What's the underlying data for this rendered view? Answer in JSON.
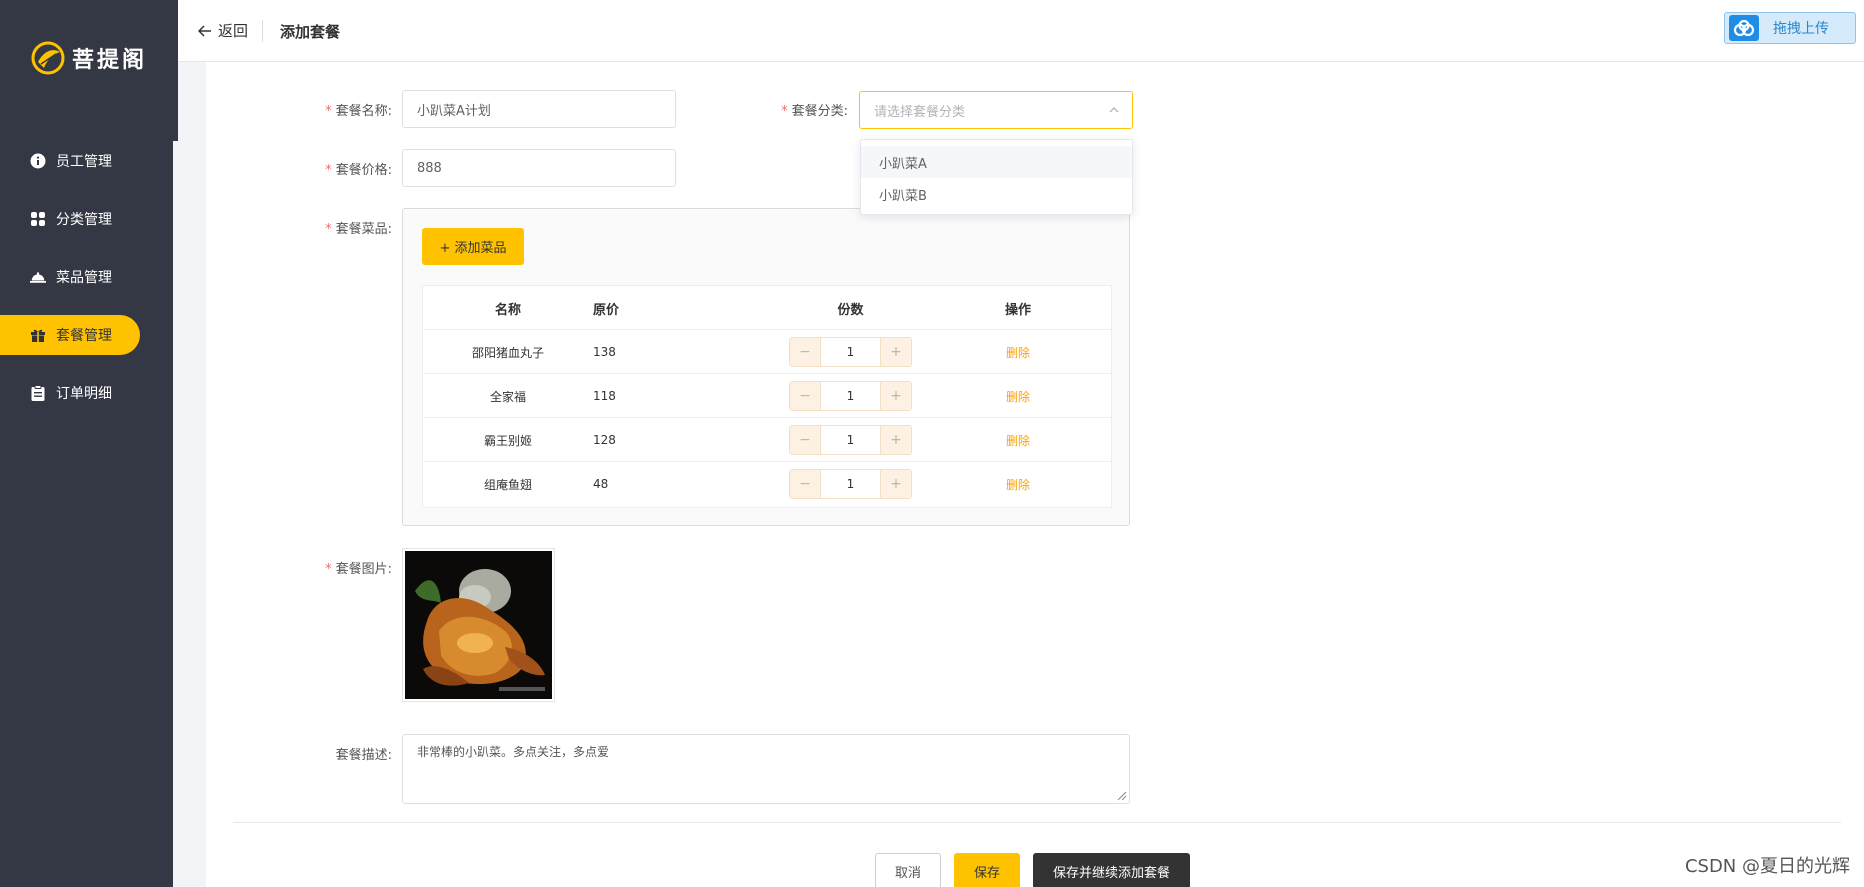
{
  "sidebar": {
    "logo_text": "菩提阁",
    "items": [
      {
        "label": "员工管理",
        "icon": "info-icon"
      },
      {
        "label": "分类管理",
        "icon": "grid-icon"
      },
      {
        "label": "菜品管理",
        "icon": "cloche-icon"
      },
      {
        "label": "套餐管理",
        "icon": "gift-icon",
        "active": true
      },
      {
        "label": "订单明细",
        "icon": "clipboard-icon"
      }
    ]
  },
  "topbar": {
    "back_label": "返回",
    "title": "添加套餐",
    "upload_label": "拖拽上传"
  },
  "form": {
    "name_label": "套餐名称:",
    "name_value": "小趴菜A计划",
    "category_label": "套餐分类:",
    "category_placeholder": "请选择套餐分类",
    "category_options": [
      "小趴菜A",
      "小趴菜B"
    ],
    "price_label": "套餐价格:",
    "price_value": "888",
    "dishes_label": "套餐菜品:",
    "add_dish_label": "+ 添加菜品",
    "image_label": "套餐图片:",
    "desc_label": "套餐描述:",
    "desc_value": "非常棒的小趴菜。多点关注，多点爱",
    "required_mark": "*"
  },
  "dish_table": {
    "headers": {
      "name": "名称",
      "price": "原价",
      "qty": "份数",
      "op": "操作"
    },
    "rows": [
      {
        "name": "邵阳猪血丸子",
        "price": "138",
        "qty": "1",
        "op": "删除"
      },
      {
        "name": "全家福",
        "price": "118",
        "qty": "1",
        "op": "删除"
      },
      {
        "name": "霸王别姬",
        "price": "128",
        "qty": "1",
        "op": "删除"
      },
      {
        "name": "组庵鱼翅",
        "price": "48",
        "qty": "1",
        "op": "删除"
      }
    ],
    "minus": "−",
    "plus": "+"
  },
  "actions": {
    "cancel": "取消",
    "save": "保存",
    "save_continue": "保存并继续添加套餐"
  },
  "watermark": "CSDN @夏日的光辉",
  "colors": {
    "sidebar_bg": "#343744",
    "accent": "#ffc200",
    "delete_link": "#ffa000",
    "dark_button": "#333333"
  }
}
